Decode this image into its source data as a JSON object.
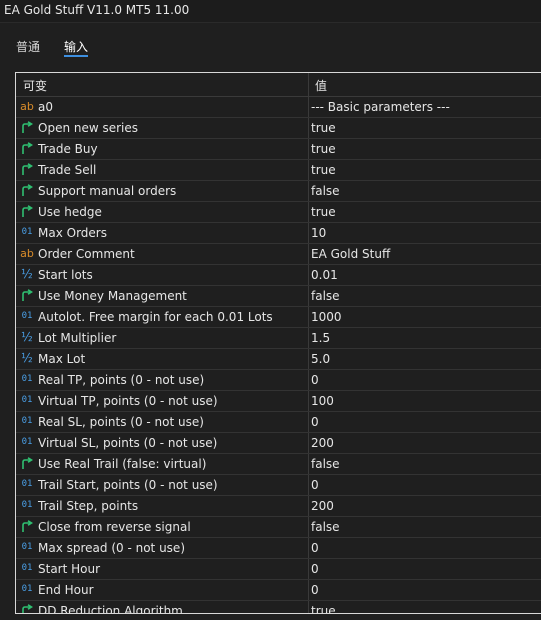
{
  "window": {
    "title": "EA Gold Stuff V11.0 MT5 11.00"
  },
  "tabs": [
    {
      "label": "普通"
    },
    {
      "label": "输入"
    }
  ],
  "grid": {
    "headers": {
      "variable": "可变",
      "value": "值"
    },
    "rows": [
      {
        "icon": "str",
        "name": "a0",
        "value": "--- Basic parameters ---"
      },
      {
        "icon": "bool",
        "name": "Open new series",
        "value": "true"
      },
      {
        "icon": "bool",
        "name": "Trade Buy",
        "value": "true"
      },
      {
        "icon": "bool",
        "name": "Trade Sell",
        "value": "true"
      },
      {
        "icon": "bool",
        "name": "Support manual orders",
        "value": "false"
      },
      {
        "icon": "bool",
        "name": "Use hedge",
        "value": "true"
      },
      {
        "icon": "int",
        "name": "Max Orders",
        "value": "10"
      },
      {
        "icon": "str",
        "name": "Order Comment",
        "value": "EA Gold Stuff"
      },
      {
        "icon": "dbl",
        "name": "Start lots",
        "value": "0.01"
      },
      {
        "icon": "bool",
        "name": "Use Money Management",
        "value": "false"
      },
      {
        "icon": "int",
        "name": "Autolot. Free margin for each 0.01 Lots",
        "value": "1000"
      },
      {
        "icon": "dbl",
        "name": "Lot Multiplier",
        "value": "1.5"
      },
      {
        "icon": "dbl",
        "name": "Max Lot",
        "value": "5.0"
      },
      {
        "icon": "int",
        "name": "Real TP, points (0 - not use)",
        "value": "0"
      },
      {
        "icon": "int",
        "name": "Virtual TP, points (0 - not use)",
        "value": "100"
      },
      {
        "icon": "int",
        "name": "Real SL, points (0 - not use)",
        "value": "0"
      },
      {
        "icon": "int",
        "name": "Virtual SL, points (0 - not use)",
        "value": "200"
      },
      {
        "icon": "bool",
        "name": "Use Real Trail (false: virtual)",
        "value": "false"
      },
      {
        "icon": "int",
        "name": "Trail Start, points (0 - not use)",
        "value": "0"
      },
      {
        "icon": "int",
        "name": "Trail Step, points",
        "value": "200"
      },
      {
        "icon": "bool",
        "name": "Close from reverse signal",
        "value": "false"
      },
      {
        "icon": "int",
        "name": "Max spread (0 - not use)",
        "value": "0"
      },
      {
        "icon": "int",
        "name": "Start Hour",
        "value": "0"
      },
      {
        "icon": "int",
        "name": "End Hour",
        "value": "0"
      },
      {
        "icon": "bool",
        "name": "DD Reduction Algorithm",
        "value": "true"
      }
    ]
  },
  "icon_glyphs": {
    "int": "01",
    "str": "ab",
    "dbl": "½"
  },
  "colors": {
    "accent": "#3d8fe0",
    "bool_icon": "#2fbf71",
    "int_icon": "#4a9fe6",
    "str_icon": "#d98c2a"
  }
}
